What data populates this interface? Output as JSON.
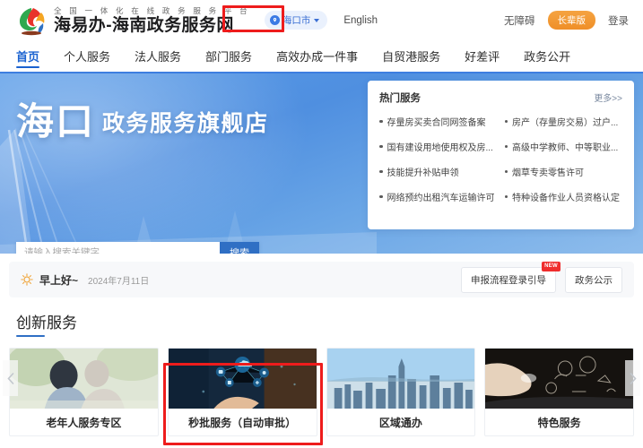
{
  "header": {
    "brand_sub": "全 国 一 体 化 在 线 政 务 服 务 平 台",
    "brand_title": "海易办-海南政务服务网",
    "logo_icon": "rainbow-leaf-logo",
    "city": "海口市",
    "city_icon": "location-pin-icon",
    "english_link": "English",
    "accessibility": "无障碍",
    "elder_mode": "长辈版",
    "login": "登录"
  },
  "nav": {
    "items": [
      {
        "label": "首页",
        "active": true
      },
      {
        "label": "个人服务",
        "active": false
      },
      {
        "label": "法人服务",
        "active": false
      },
      {
        "label": "部门服务",
        "active": false
      },
      {
        "label": "高效办成一件事",
        "active": false
      },
      {
        "label": "自贸港服务",
        "active": false
      },
      {
        "label": "好差评",
        "active": false
      },
      {
        "label": "政务公开",
        "active": false
      }
    ]
  },
  "banner": {
    "title_big": "海口",
    "title_small": "政务服务旗舰店",
    "search_placeholder": "请输入搜索关键字",
    "search_value": "",
    "search_button": "搜索"
  },
  "hot_services": {
    "title": "热门服务",
    "more": "更多>>",
    "items": [
      "存量房买卖合同网签备案",
      "房产（存量房交易）过户...",
      "国有建设用地使用权及房...",
      "高级中学教师、中等职业...",
      "技能提升补贴申领",
      "烟草专卖零售许可",
      "网络预约出租汽车运输许可",
      "特种设备作业人员资格认定"
    ]
  },
  "greeting": {
    "icon": "sun-icon",
    "text": "早上好~",
    "date": "2024年7月11日",
    "guide_button": "申报流程登录引导",
    "guide_badge": "NEW",
    "notice_button": "政务公示"
  },
  "innovation": {
    "section_title": "创新服务",
    "prev_icon": "chevron-left-icon",
    "next_icon": "chevron-right-icon",
    "cards": [
      {
        "label": "老年人服务专区",
        "art": "art-elderly",
        "highlighted": false
      },
      {
        "label": "秒批服务（自动审批）",
        "art": "art-tech",
        "highlighted": true
      },
      {
        "label": "区域通办",
        "art": "art-city",
        "highlighted": false
      },
      {
        "label": "特色服务",
        "art": "art-dark",
        "highlighted": false
      }
    ]
  },
  "colors": {
    "accent": "#2f6fc4",
    "nav_underline": "#3d7ee0",
    "annotation": "#ee1c1c",
    "elder_pill": "#ef8f28",
    "badge": "#ef2d2d"
  }
}
